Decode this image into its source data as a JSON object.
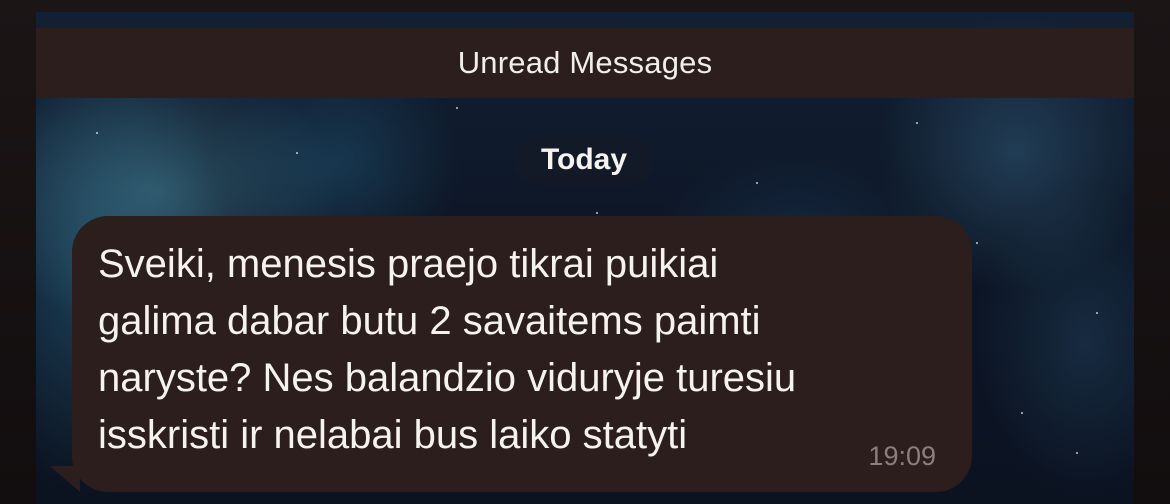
{
  "banner": {
    "label": "Unread Messages"
  },
  "date_separator": {
    "label": "Today"
  },
  "message": {
    "text": "Sveiki, menesis praejo tikrai puikiai\ngalima dabar butu 2 savaitems paimti\nnaryste? Nes balandzio viduryje turesiu\nisskristi ir nelabai bus laiko statyti",
    "time": "19:09",
    "direction": "incoming"
  },
  "colors": {
    "bubble": "#2b1e1c",
    "banner": "#2b1e1c",
    "text": "#f6f2f0",
    "timestamp": "#8a7f7c"
  }
}
